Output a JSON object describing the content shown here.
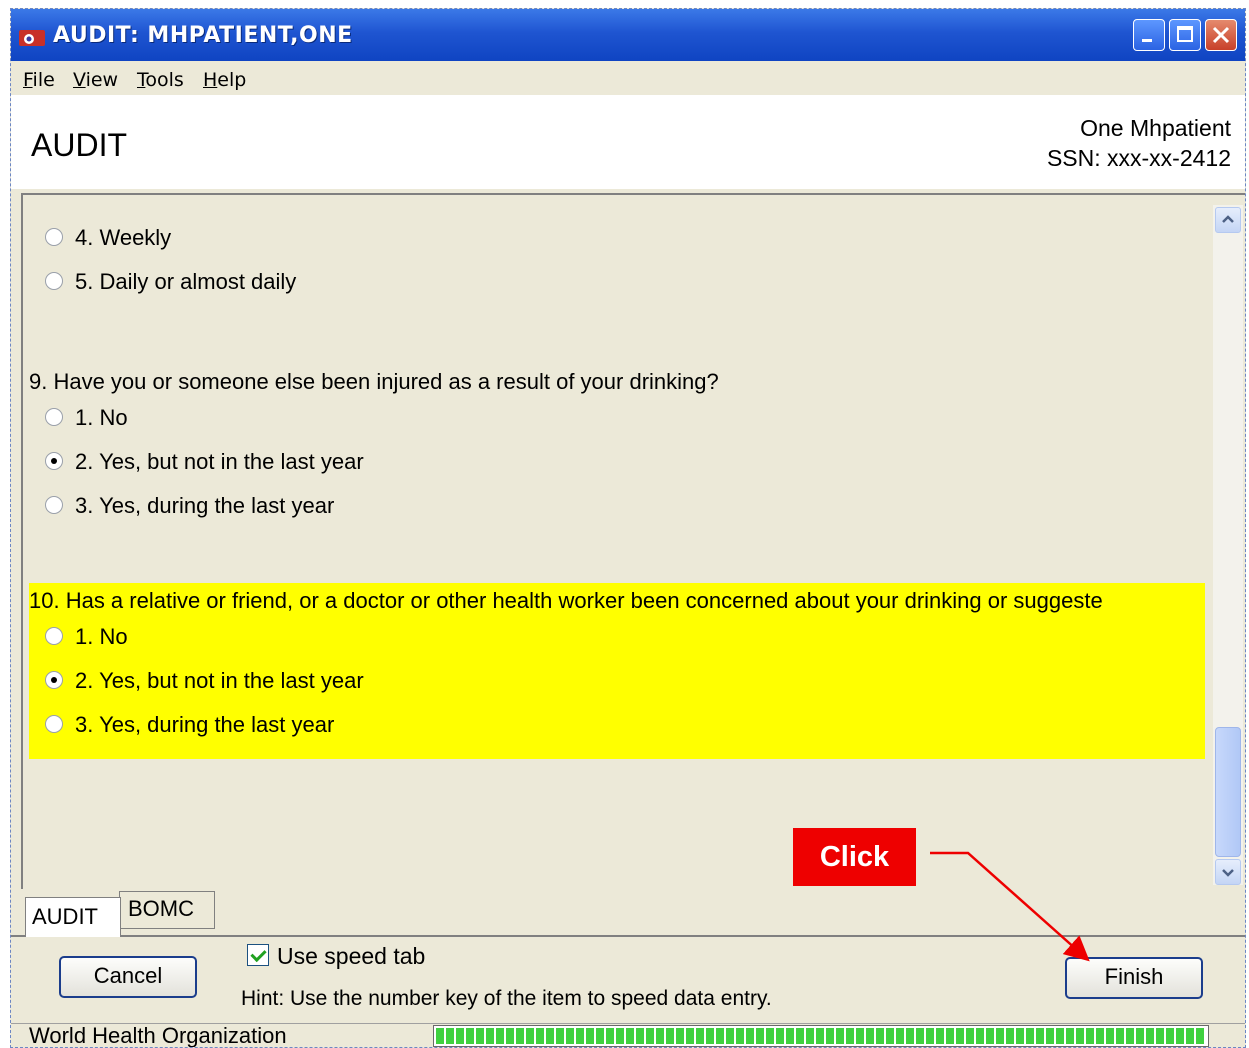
{
  "window": {
    "title": "AUDIT: MHPATIENT,ONE"
  },
  "menu": {
    "file": "ile",
    "file_key": "F",
    "view": "iew",
    "view_key": "V",
    "tools": "ools",
    "tools_key": "T",
    "help": "elp",
    "help_key": "H"
  },
  "header": {
    "title": "AUDIT",
    "patient_name": "One Mhpatient",
    "ssn": "SSN: xxx-xx-2412"
  },
  "questions": [
    {
      "number_text": "",
      "options": [
        {
          "label": "4. Weekly",
          "selected": false
        },
        {
          "label": "5. Daily or almost daily",
          "selected": false
        }
      ]
    },
    {
      "text": "9. Have you or someone else been injured as a result of your drinking?",
      "options": [
        {
          "label": "1. No",
          "selected": false
        },
        {
          "label": "2. Yes, but not in the last year",
          "selected": true
        },
        {
          "label": "3. Yes, during the last year",
          "selected": false
        }
      ]
    },
    {
      "text": "10. Has a relative or friend, or a doctor or other health worker been concerned about your drinking or suggeste",
      "highlighted": true,
      "options": [
        {
          "label": "1. No",
          "selected": false
        },
        {
          "label": "2. Yes, but not in the last year",
          "selected": true
        },
        {
          "label": "3. Yes, during the last year",
          "selected": false
        }
      ]
    }
  ],
  "tabs": [
    "AUDIT",
    "BOMC"
  ],
  "footer": {
    "cancel_label": "Cancel",
    "speed_tab_label": "Use speed tab",
    "speed_tab_checked": true,
    "hint": "Hint: Use the number key of the item to speed data entry.",
    "finish_label": "Finish"
  },
  "status": {
    "text": "World Health Organization",
    "progress_percent": 100
  },
  "annotation": {
    "callout": "Click",
    "color": "#ee0000"
  },
  "colors": {
    "titlebar": "#1f55d1",
    "highlight": "#ffff00"
  }
}
